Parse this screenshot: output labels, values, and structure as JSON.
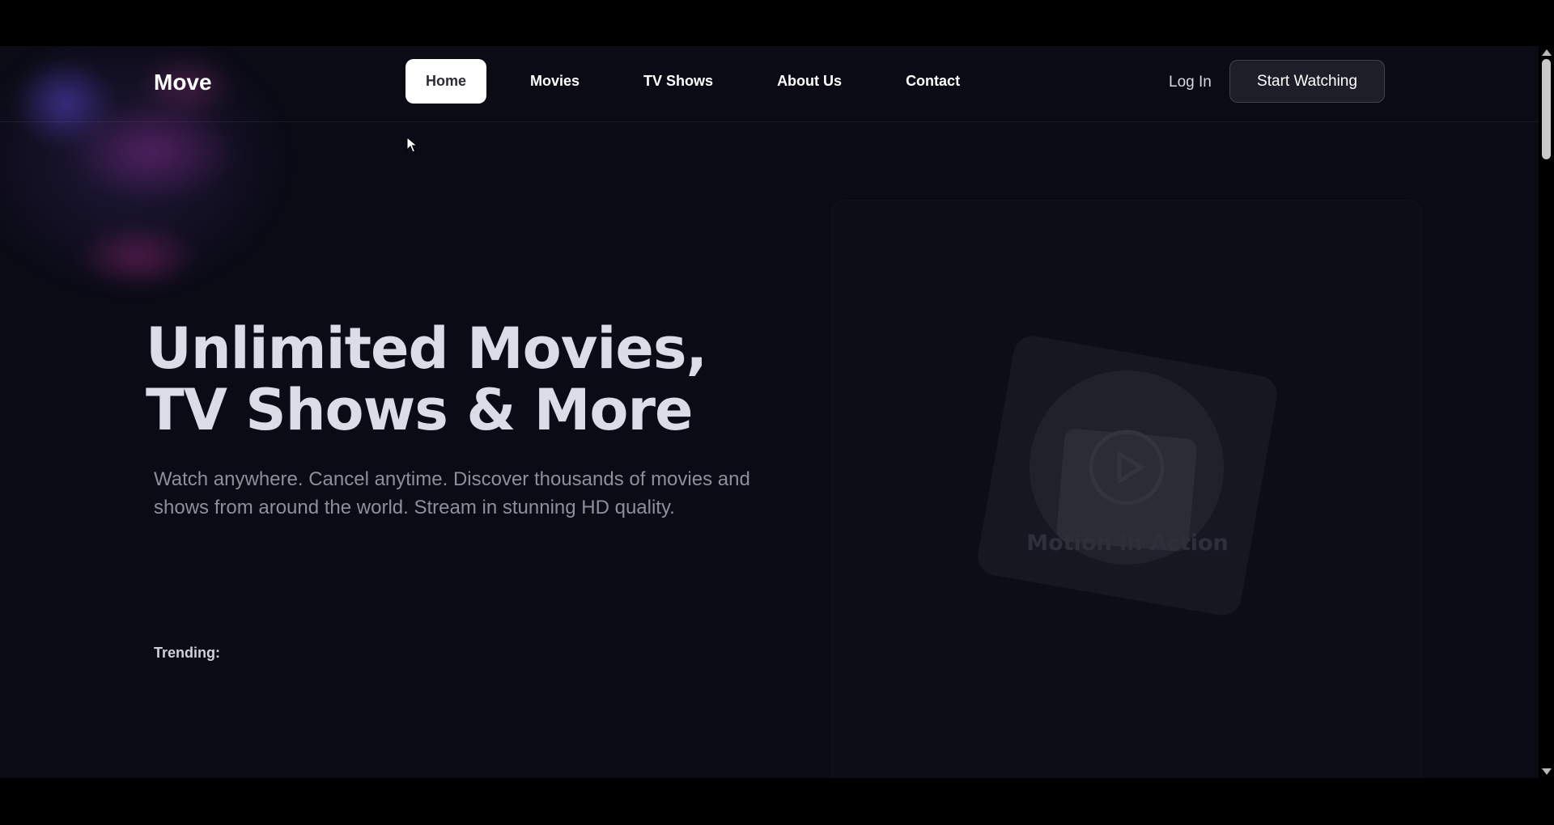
{
  "nav": {
    "brand": "Move",
    "links": [
      {
        "label": "Home",
        "active": true
      },
      {
        "label": "Movies",
        "active": false
      },
      {
        "label": "TV Shows",
        "active": false
      },
      {
        "label": "About Us",
        "active": false
      },
      {
        "label": "Contact",
        "active": false
      }
    ],
    "login_label": "Log In",
    "cta_label": "Start Watching"
  },
  "hero": {
    "title_line1": "Unlimited Movies,",
    "title_line2": "TV Shows & More",
    "subtitle": "Watch anywhere. Cancel anytime. Discover thousands of movies and shows from around the world. Stream in stunning HD quality.",
    "trending_label": "Trending:"
  },
  "video": {
    "label": "Motion in Action",
    "icon": "play-icon"
  },
  "colors": {
    "background": "#0b0b16",
    "active_nav_bg": "#ffffff",
    "title_text": "#dcdbe8",
    "subtitle_text": "#8e8e9c"
  }
}
